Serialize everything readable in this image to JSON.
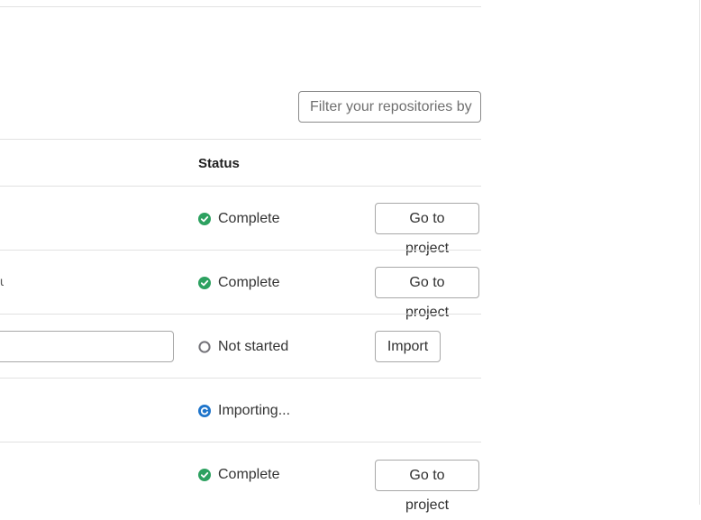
{
  "filter": {
    "placeholder": "Filter your repositories by"
  },
  "table": {
    "status_header": "Status",
    "rows": [
      {
        "status": "Complete",
        "status_type": "complete",
        "action": "Go to project"
      },
      {
        "status": "Complete",
        "status_type": "complete",
        "action": "Go to project"
      },
      {
        "status": "Not started",
        "status_type": "not-started",
        "action": "Import"
      },
      {
        "status": "Importing...",
        "status_type": "importing",
        "action": ""
      },
      {
        "status": "Complete",
        "status_type": "complete",
        "action": "Go to project"
      }
    ]
  },
  "row2_truncated_text": "u",
  "colors": {
    "complete": "#2da160",
    "not_started": "#737278",
    "importing": "#1f75cb",
    "border": "#e1e1e1"
  },
  "icons": {
    "complete": "check-circle-icon",
    "not_started": "empty-circle-icon",
    "importing": "loading-icon"
  }
}
